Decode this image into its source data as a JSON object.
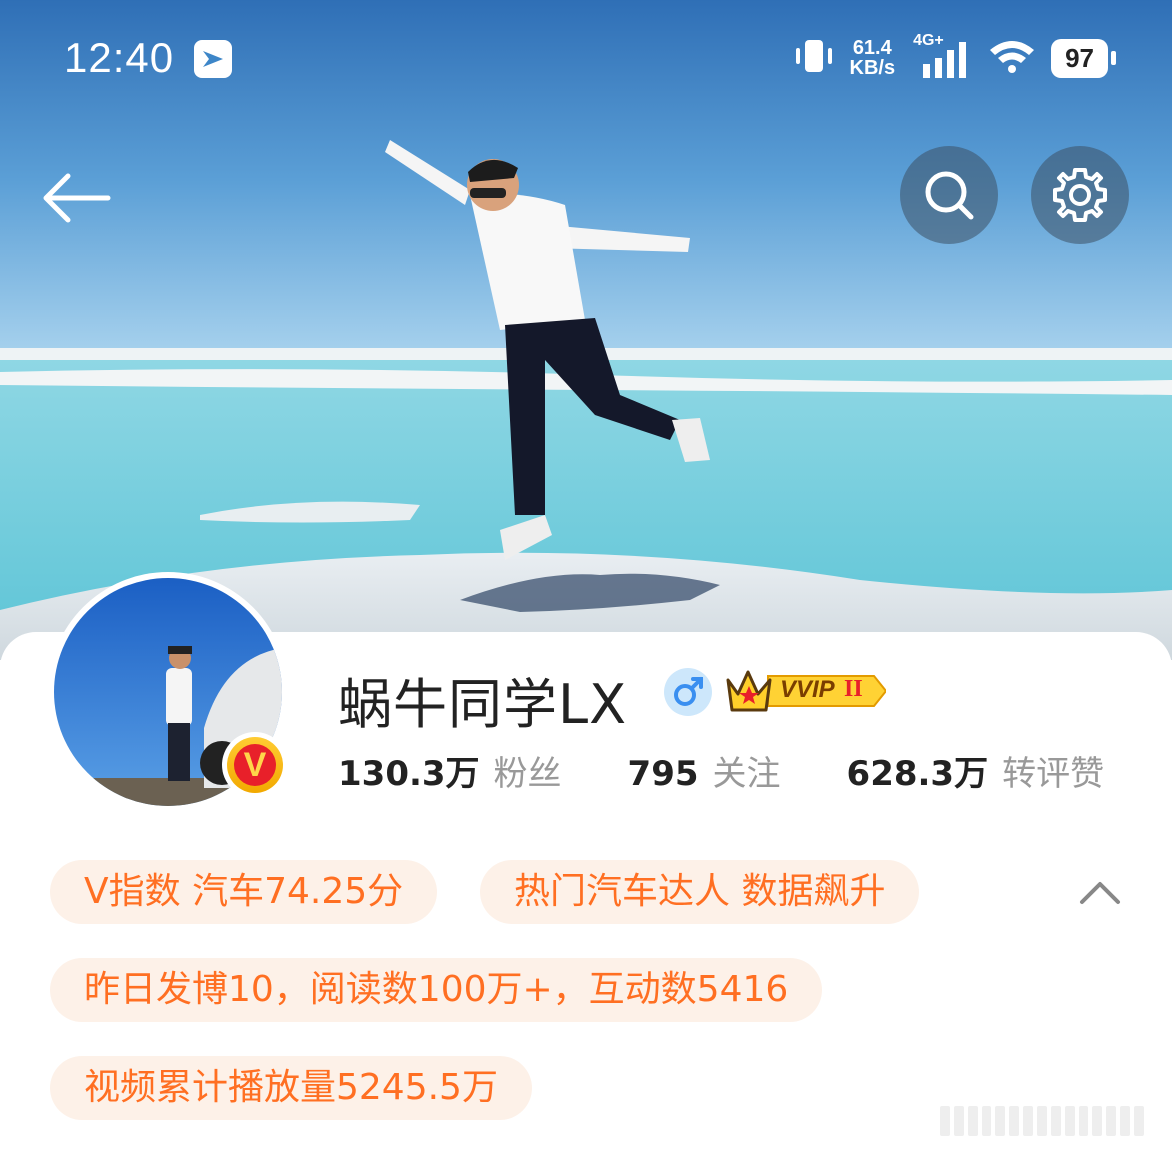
{
  "status_bar": {
    "time": "12:40",
    "net_speed_value": "61.4",
    "net_speed_unit": "KB/s",
    "network_type": "4G+",
    "battery": "97"
  },
  "header": {
    "back_icon": "arrow-left-icon",
    "search_icon": "search-icon",
    "settings_icon": "gear-icon"
  },
  "profile": {
    "name": "蜗牛同学LX",
    "gender_icon": "male-icon",
    "vvip_label": "VVIP",
    "vvip_level": "II",
    "verified_badge": "V",
    "stats": [
      {
        "value": "130.3万",
        "label": "粉丝"
      },
      {
        "value": "795",
        "label": "关注"
      },
      {
        "value": "628.3万",
        "label": "转评赞"
      }
    ]
  },
  "tags": {
    "v_index": "V指数 汽车74.25分",
    "hot_expert": "热门汽车达人 数据飙升",
    "yesterday": "昨日发博10，阅读数100万+，互动数5416",
    "video_plays": "视频累计播放量5245.5万"
  },
  "colors": {
    "tag_text": "#ff6f22",
    "tag_bg": "#fdf1e8",
    "sky": "#3d86c8",
    "water": "#6ec9d8"
  }
}
